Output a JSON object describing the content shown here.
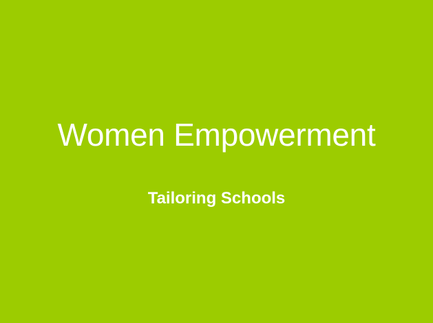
{
  "slide": {
    "title": "Women Empowerment",
    "subtitle": "Tailoring Schools",
    "background_color": "#9ccc00",
    "text_color": "#ffffff"
  }
}
